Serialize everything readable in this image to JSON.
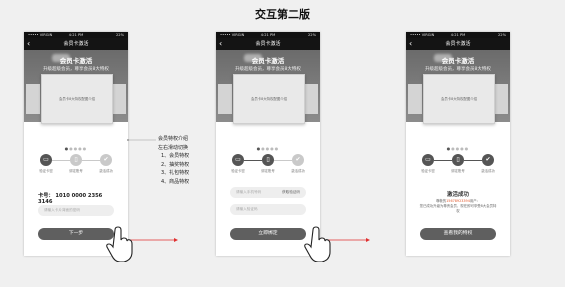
{
  "page_title": "交互第二版",
  "status": {
    "carrier": "••••• VIRGIN",
    "time": "4:21 PM",
    "battery": "22%"
  },
  "nav": {
    "back": "‹",
    "title": "会员卡激活"
  },
  "banner": {
    "title": "会员卡激活",
    "subtitle": "升级超级会员，尊享会员8大特权",
    "card_text": "会员卡8大特权配图介绍"
  },
  "steps": {
    "labels": [
      "验证卡密",
      "绑定账号",
      "激活成功"
    ],
    "check": "✔",
    "icons": [
      "card-icon",
      "phone-icon",
      "check-icon"
    ]
  },
  "screen1": {
    "card_no": "卡号： 1010 0000 2356 3146",
    "password_placeholder": "请输入卡片背面的密码",
    "button": "下一步"
  },
  "screen2": {
    "phone_placeholder": "请输入手机号码",
    "sms_button": "获取验证码",
    "code_placeholder": "请输入验证码",
    "button": "立即绑定"
  },
  "screen3": {
    "success": "激活成功",
    "desc_prefix": "尊敬的",
    "desc_highlight": "15678923394",
    "desc_middle": "用户：",
    "desc_rest": "您已成功升级为尊贵会员，现在即可享受8大会员特权",
    "button": "查看我的特权"
  },
  "annotation": [
    "会员特权介绍",
    "左右滑动切换",
    "1、会员特权",
    "2、抽奖特权",
    "3、礼包特权",
    "4、商品特权"
  ],
  "colors": {
    "accent": "#e2582b",
    "arrow": "#e03030"
  }
}
